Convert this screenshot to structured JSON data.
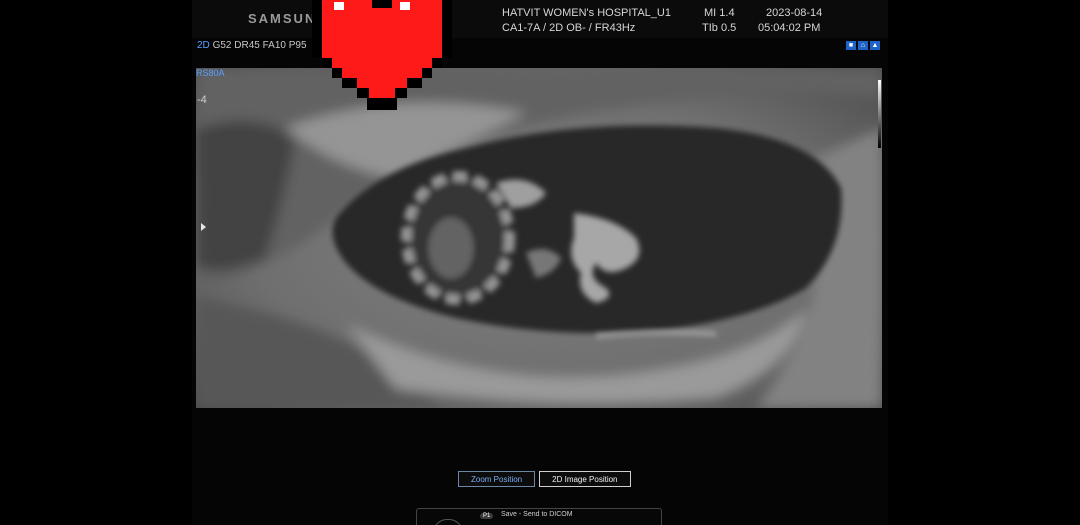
{
  "header": {
    "brand": "SAMSUNG",
    "hospital": "HATVIT WOMEN's HOSPITAL_U1",
    "probe_info": "CA1-7A / 2D OB- / FR43Hz",
    "mi": "MI 1.4",
    "tib": "TIb 0.5",
    "date": "2023-08-14",
    "time": "05:04:02 PM"
  },
  "left_panel": {
    "mode": "2D",
    "params": "G52 DR45 FA10 P95",
    "probe_label": "RS80A",
    "depth_marker": "-4"
  },
  "icons": {
    "heart": "heart-sticker-icon",
    "status": [
      "freeze-icon",
      "home-icon",
      "warning-icon"
    ]
  },
  "buttons": {
    "zoom_position": "Zoom Position",
    "image_position": "2D Image Position"
  },
  "footer": {
    "key_label": "P1",
    "save_text": "Save - Send to DICOM"
  },
  "colors": {
    "accent_blue": "#5aa0ff",
    "heart_red": "#ff1a1a",
    "background": "#000000"
  }
}
